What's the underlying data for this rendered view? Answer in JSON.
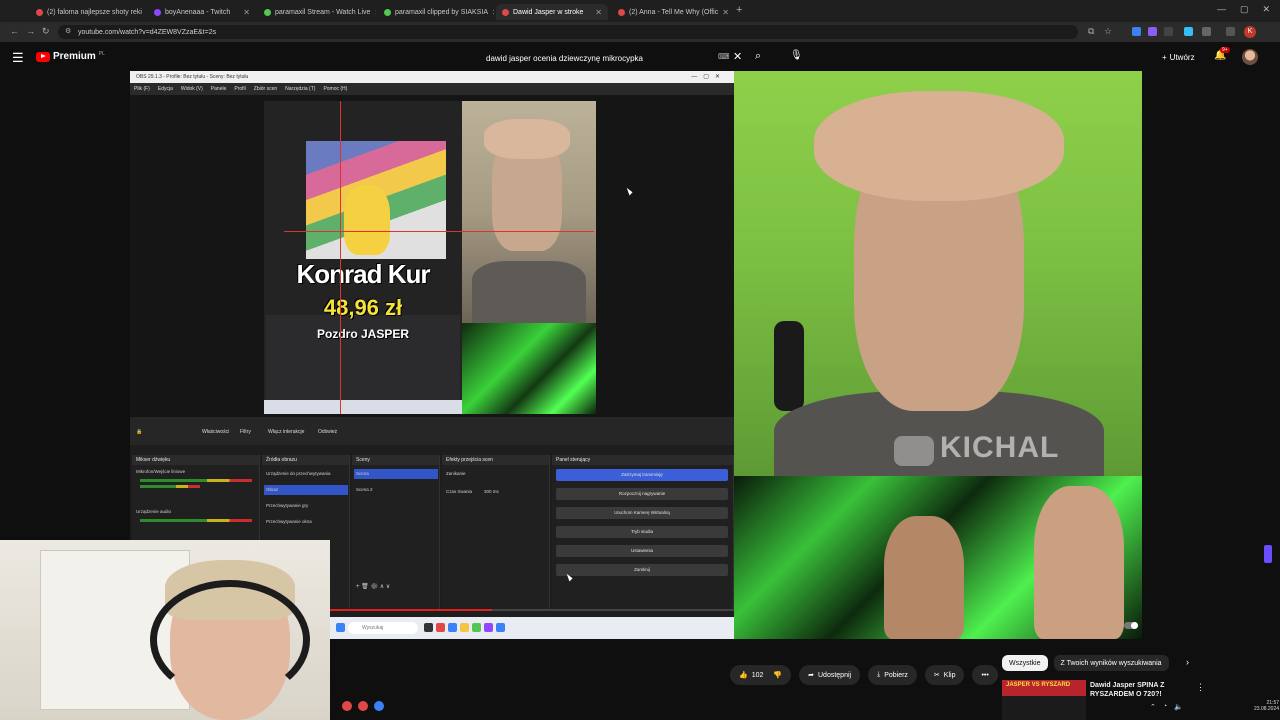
{
  "browser": {
    "tabs": [
      {
        "label": "(2) faloma najlepsze shoty reki",
        "color": "#e04848"
      },
      {
        "label": "boyAnenaaa - Twitch",
        "color": "#9146ff"
      },
      {
        "label": "paramaxil Stream - Watch Live",
        "color": "#53c653"
      },
      {
        "label": "paramaxil clipped by SIAKSIA",
        "color": "#53c653"
      },
      {
        "label": "Dawid Jasper w stroke",
        "color": "#e04848"
      },
      {
        "label": "(2) Anna - Tell Me Why (Offic",
        "color": "#e04848"
      }
    ],
    "new_tab": "+",
    "url": "youtube.com/watch?v=d4ZEW8VZzaE&t=2s",
    "profile_initial": "K"
  },
  "youtube": {
    "logo_text": "Premium",
    "logo_region": "PL",
    "search_query": "dawid jasper ocenia dziewczynę mikrocypka",
    "create_label": "Utwórz",
    "notif_count": "9+"
  },
  "obs": {
    "title": "OBS 29.1.3 - Profile: Bez tytułu - Sceny: Bez tytułu",
    "menu": [
      "Plik (F)",
      "Edycja",
      "Widok (V)",
      "Panele",
      "Profil",
      "Zbiór scen",
      "Narzędzia (T)",
      "Pomoc (H)"
    ],
    "donation": {
      "name": "Konrad Kur",
      "amount": "48,96 zł",
      "message": "Pozdro JASPER"
    },
    "toolbar": [
      "Właściwości",
      "Filtry",
      "Włącz interakcje",
      "Odśwież"
    ],
    "docks": {
      "mixer": {
        "title": "Mikser dźwięku",
        "items": [
          "Mikrofon/Wejście liniowe",
          "Urządzenie audio"
        ]
      },
      "sources": {
        "title": "Źródła obrazu",
        "items": [
          "Urządzenie do przechwytywania",
          "Obraz",
          "Przechwytywanie gry",
          "Przechwytywanie okna"
        ]
      },
      "scenes": {
        "title": "Sceny",
        "items": [
          "Scena",
          "Scena 2"
        ]
      },
      "transitions": {
        "title": "Efekty przejścia scen",
        "type": "Zanikanie",
        "duration_label": "Czas trwania",
        "duration": "300 ms"
      },
      "controls": {
        "title": "Panel sterujący",
        "buttons": [
          "Zatrzymaj transmisję",
          "Rozpocznij nagrywanie",
          "Uruchom Kamerę Wirtualną",
          "Tryb studia",
          "Ustawienia",
          "Zamknij"
        ]
      }
    },
    "taskbar_search": "Wyszukaj"
  },
  "watermark": "KICHAL",
  "player_controls": [
    "autoplay",
    "subtitles",
    "settings",
    "miniplayer",
    "theater",
    "fullscreen"
  ],
  "actions": {
    "likes": "102",
    "share": "Udostępnij",
    "download": "Pobierz",
    "clip": "Klip"
  },
  "filter_chips": [
    "Wszystkie",
    "Z Twoich wyników wyszukiwania"
  ],
  "recommendation": {
    "title": "Dawid Jasper SPINA Z RYSZARDEM O 720?!",
    "thumb_text": "JASPER VS RYSZARD"
  },
  "clock": {
    "time": "21:57",
    "date": "23.08.2024"
  }
}
